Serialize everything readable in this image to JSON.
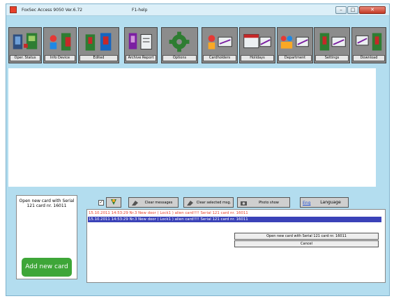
{
  "window": {
    "title": "FoxSec Access 9050 Ver.6.72",
    "help_menu": "F1-help",
    "close_label": "✕"
  },
  "toolbar": {
    "buttons": [
      {
        "label": "Oper. Status",
        "icon": "oper-status-icon"
      },
      {
        "label": "Info Device",
        "icon": "info-device-icon"
      },
      {
        "label": "Edited",
        "icon": "edited-icon"
      },
      {
        "label": "Archive Report",
        "icon": "archive-report-icon"
      },
      {
        "label": "Options",
        "icon": "gear-icon"
      },
      {
        "label": "Cardholders",
        "icon": "cardholders-icon"
      },
      {
        "label": "Holidays",
        "icon": "holidays-icon"
      },
      {
        "label": "Department",
        "icon": "department-icon"
      },
      {
        "label": "Settings",
        "icon": "settings-icon"
      },
      {
        "label": "Download",
        "icon": "download-icon"
      }
    ]
  },
  "left_panel": {
    "notice": "Open new card with Serial 121 card nr. 16011",
    "add_button": "Add new card"
  },
  "controls": {
    "clear_messages": "Clear messages",
    "clear_selected": "Clear selected msg.",
    "photo_show": "Photo show",
    "language_tag": "Eng",
    "language": "Language",
    "checkbox_checked": true
  },
  "log": {
    "rows": [
      "15.10.2011 14:53:29 Nr.3 New door ( Lock1 ) alien card!!!! Serial 121 card nr. 16011",
      "15.10.2011 14:53:29 Nr.3 New door ( Lock1 ) alien card!!!! Serial 121 card nr. 16011"
    ]
  },
  "dialog": {
    "open_button": "Open new card with Serial 121 card nr. 16011",
    "cancel_button": "Cancel"
  },
  "colors": {
    "accent": "#3a42b8",
    "alert_text": "#e8402a",
    "add_button": "#3ea638",
    "window_bg": "#b3ddef"
  }
}
